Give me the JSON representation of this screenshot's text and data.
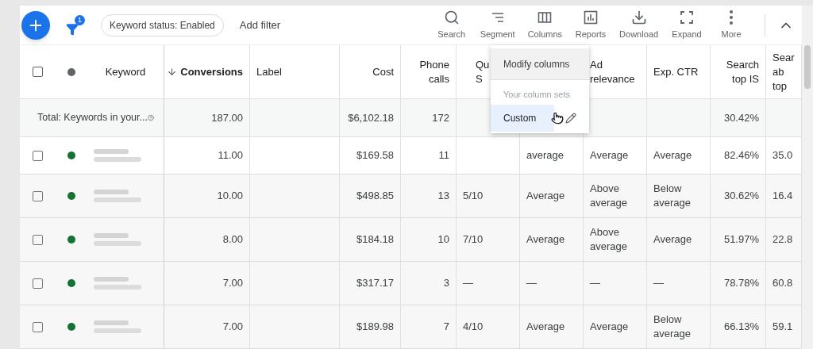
{
  "toolbar": {
    "filter_badge": "1",
    "chips": [
      "Keyword status: Enabled"
    ],
    "add_filter": "Add filter",
    "actions": [
      {
        "kind": "search",
        "label": "Search"
      },
      {
        "kind": "segment",
        "label": "Segment"
      },
      {
        "kind": "columns",
        "label": "Columns"
      },
      {
        "kind": "reports",
        "label": "Reports"
      },
      {
        "kind": "download",
        "label": "Download"
      },
      {
        "kind": "expand",
        "label": "Expand"
      },
      {
        "kind": "more",
        "label": "More"
      }
    ]
  },
  "table": {
    "select_all_checked": false,
    "columns": [
      {
        "lines": [
          "Keyword"
        ],
        "sorted": false
      },
      {
        "lines": [
          "Conversions"
        ],
        "sorted": true
      },
      {
        "lines": [
          "Label"
        ],
        "sorted": false
      },
      {
        "lines": [
          "Cost"
        ],
        "sorted": false
      },
      {
        "lines": [
          "Phone",
          "calls"
        ],
        "sorted": false
      },
      {
        "lines": [
          "Qu",
          "S"
        ],
        "sorted": false
      },
      null,
      {
        "lines": [
          "Ad",
          "relevance"
        ],
        "sorted": false
      },
      {
        "lines": [
          "Exp. CTR"
        ],
        "sorted": false
      },
      {
        "lines": [
          "Search",
          "top IS"
        ],
        "sorted": false
      },
      {
        "lines": [
          "Sear",
          "ab",
          "top"
        ],
        "sorted": false
      }
    ],
    "total": {
      "cells": [
        "Total: Keywords in your...",
        "187.00",
        null,
        "$6,102.18",
        "172",
        null,
        null,
        null,
        null,
        "30.42%",
        null
      ]
    },
    "rows": [
      {
        "checked": false,
        "color": "#137333",
        "cells": [
          null,
          "11.00",
          null,
          "$169.58",
          "11",
          null,
          "average",
          "Average",
          "Average",
          "82.46%",
          "35.0"
        ]
      },
      {
        "checked": false,
        "color": "#137333",
        "cells": [
          null,
          "10.00",
          null,
          "$498.85",
          "13",
          "5/10",
          "Average",
          "Above average",
          "Below average",
          "30.62%",
          "16.4"
        ]
      },
      {
        "checked": false,
        "color": "#137333",
        "cells": [
          null,
          "8.00",
          null,
          "$184.18",
          "10",
          "7/10",
          "Average",
          "Above average",
          "Average",
          "51.97%",
          "22.8"
        ]
      },
      {
        "checked": false,
        "color": "#137333",
        "cells": [
          null,
          "7.00",
          null,
          "$317.17",
          "3",
          "—",
          "—",
          "—",
          "—",
          "78.78%",
          "60.8"
        ]
      },
      {
        "checked": false,
        "color": "#137333",
        "cells": [
          null,
          "7.00",
          null,
          "$189.98",
          "7",
          "4/10",
          "Average",
          "Average",
          "Below average",
          "66.13%",
          "59.1"
        ]
      }
    ]
  },
  "menu": {
    "action": "Modify columns",
    "sets_heading": "Your column sets",
    "sets": [
      {
        "label": "Custom",
        "selected": true
      }
    ]
  }
}
